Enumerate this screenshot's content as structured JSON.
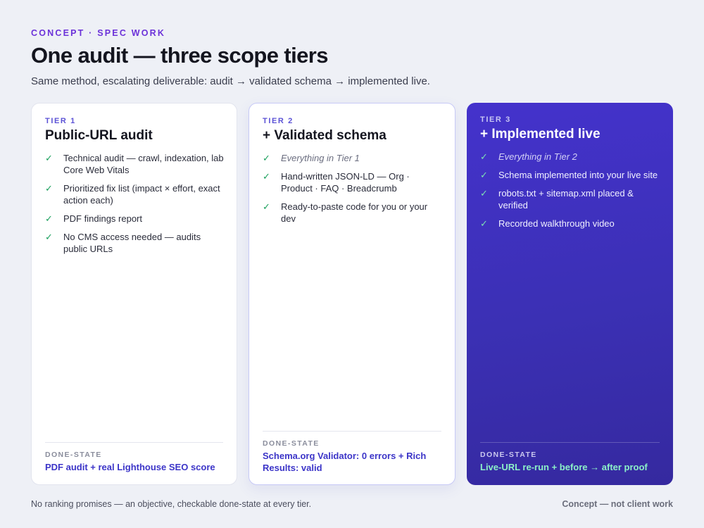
{
  "header": {
    "eyebrow": "CONCEPT · SPEC WORK",
    "title": "One audit — three scope tiers",
    "subtitle": "Same method, escalating deliverable: audit → validated schema → implemented live."
  },
  "tiers": [
    {
      "label": "TIER 1",
      "title": "Public-URL audit",
      "features": [
        {
          "text": "Technical audit — crawl, indexation, lab Core Web Vitals",
          "italic": false
        },
        {
          "text": "Prioritized fix list (impact × effort, exact action each)",
          "italic": false
        },
        {
          "text": "PDF findings report",
          "italic": false
        },
        {
          "text": "No CMS access needed — audits public URLs",
          "italic": false
        }
      ],
      "done_label": "DONE-STATE",
      "done_value": "PDF audit + real Lighthouse SEO score"
    },
    {
      "label": "TIER 2",
      "title": "+ Validated schema",
      "features": [
        {
          "text": "Everything in Tier 1",
          "italic": true
        },
        {
          "text": "Hand-written JSON-LD — Org · Product · FAQ · Breadcrumb",
          "italic": false
        },
        {
          "text": "Ready-to-paste code for you or your dev",
          "italic": false
        }
      ],
      "done_label": "DONE-STATE",
      "done_value": "Schema.org Validator: 0 errors + Rich Results: valid"
    },
    {
      "label": "TIER 3",
      "title": "+ Implemented live",
      "features": [
        {
          "text": "Everything in Tier 2",
          "italic": true
        },
        {
          "text": "Schema implemented into your live site",
          "italic": false
        },
        {
          "text": "robots.txt + sitemap.xml placed & verified",
          "italic": false
        },
        {
          "text": "Recorded walkthrough video",
          "italic": false
        }
      ],
      "done_label": "DONE-STATE",
      "done_value": "Live-URL re-run + before → after proof"
    }
  ],
  "check_icon": "check-icon",
  "footer": {
    "note": "No ranking promises — an objective, checkable done-state at every tier.",
    "tag": "Concept — not client work"
  },
  "colors": {
    "accent": "#6c32d9",
    "featured_bg": "#3f31c2",
    "check": "#1aa05c"
  }
}
